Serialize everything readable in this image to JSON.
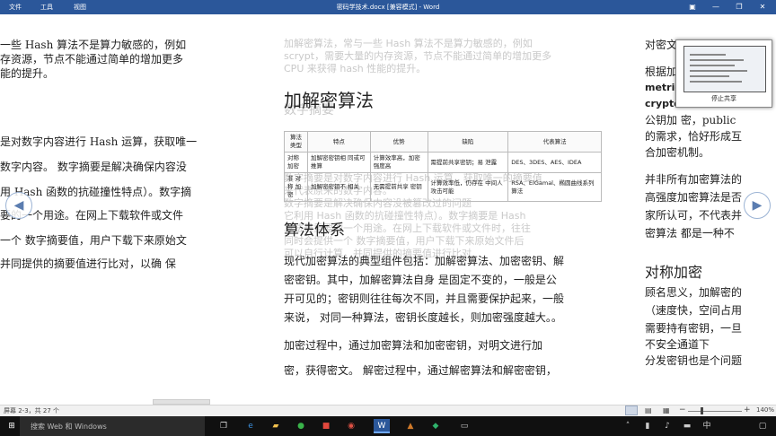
{
  "titlebar": {
    "menu": [
      "文件",
      "工具",
      "视图"
    ],
    "title": "密码学技术.docx [兼容模式] - Word"
  },
  "left_page": {
    "lines": [
      "一些 Hash 算法不是算力敏感的，例如",
      "存资源，节点不能通过简单的增加更多",
      "能的提升。",
      "是对数字内容进行 Hash 运算，获取唯一",
      "数字内容。 数字摘要是解决确保内容没",
      "用 Hash 函数的抗碰撞性特点）。数字摘",
      "要的一个用途。在网上下载软件或文件",
      "一个 数字摘要值，用户下载下来原始文",
      "并同提供的摘要值进行比对，以确 保"
    ]
  },
  "middle_page": {
    "ghost_lines": [
      "加解密算法，常与一些 Hash 算法不是算力敏感的，例如",
      "scrypt，需要大量的内存资源，节点不能通过简单的增加更多",
      "CPU 来获得 hash 性能的提升。",
      "数字摘要",
      "数字摘要是对数字内容进行 Hash 运算，获取唯一的摘要值",
      "来代表原来的数字内容。",
      "数字摘要是解决确保内容没被篡改过的问题",
      "它利用 Hash 函数的抗碰撞性特点）。数字摘要是 Hash",
      "算法最重要的一个用途。在网上下载软件或文件时，往往",
      "同时会提供一个 数字摘要值，用户下载下来原始文件后",
      "可以自行计算，并同提供的摘要值进行比对"
    ],
    "heading1": "加解密算法",
    "table": {
      "headers": [
        "算法 类型",
        "特点",
        "优势",
        "缺陷",
        "代表算法"
      ],
      "rows": [
        [
          "对称 加密",
          "加解密密钥相 同或可推算",
          "计算效率高，加密强度高",
          "需提前共享密钥；易 泄露",
          "DES、3DES、AES、IDEA"
        ],
        [
          "非 对称 加密",
          "加解密密钥不 相关",
          "无需提前共享 密钥",
          "计算效率低，仍存在 中间人攻击可能",
          "RSA、ElGamal、椭圆曲线系列算法"
        ]
      ]
    },
    "heading2": "算法体系",
    "paragraph1": [
      "现代加密算法的典型组件包括：加解密算法、加密密钥、解",
      "密密钥。其中，加解密算法自身 是固定不变的，一般是公",
      "开可见的；密钥则往往每次不同，并且需要保护起来，一般",
      "来说， 对同一种算法，密钥长度越长，则加密强度越大。。"
    ],
    "paragraph2": [
      "加密过程中，通过加密算法和加密密钥，对明文进行加",
      "密，获得密文。 解密过程中，通过解密算法和解密密钥，"
    ]
  },
  "right_page": {
    "lines1": [
      "对密文",
      "",
      "根据加",
      "metric",
      "crypto",
      "公钥加 密，public",
      "的需求，恰好形成互",
      "合加密机制。"
    ],
    "lines2": [
      "并非所有加密算法的",
      "高强度加密算法是否",
      "家所认可，不代表并",
      "密算法 都是一种不"
    ],
    "heading": "对称加密",
    "lines3": [
      "顾名思义，加解密的",
      "（速度快，空间占用",
      "需要持有密钥，一旦",
      "不安全通道下",
      "分发密钥也是个问题"
    ]
  },
  "share_popup": {
    "stop_label": "停止共享"
  },
  "statusbar": {
    "page_info": "屏幕 2-3，共 27 个",
    "zoom": "140%"
  },
  "taskbar": {
    "search_placeholder": "搜索 Web 和 Windows"
  },
  "colors": {
    "title_blue": "#2b579a",
    "taskbar": "#101010"
  }
}
